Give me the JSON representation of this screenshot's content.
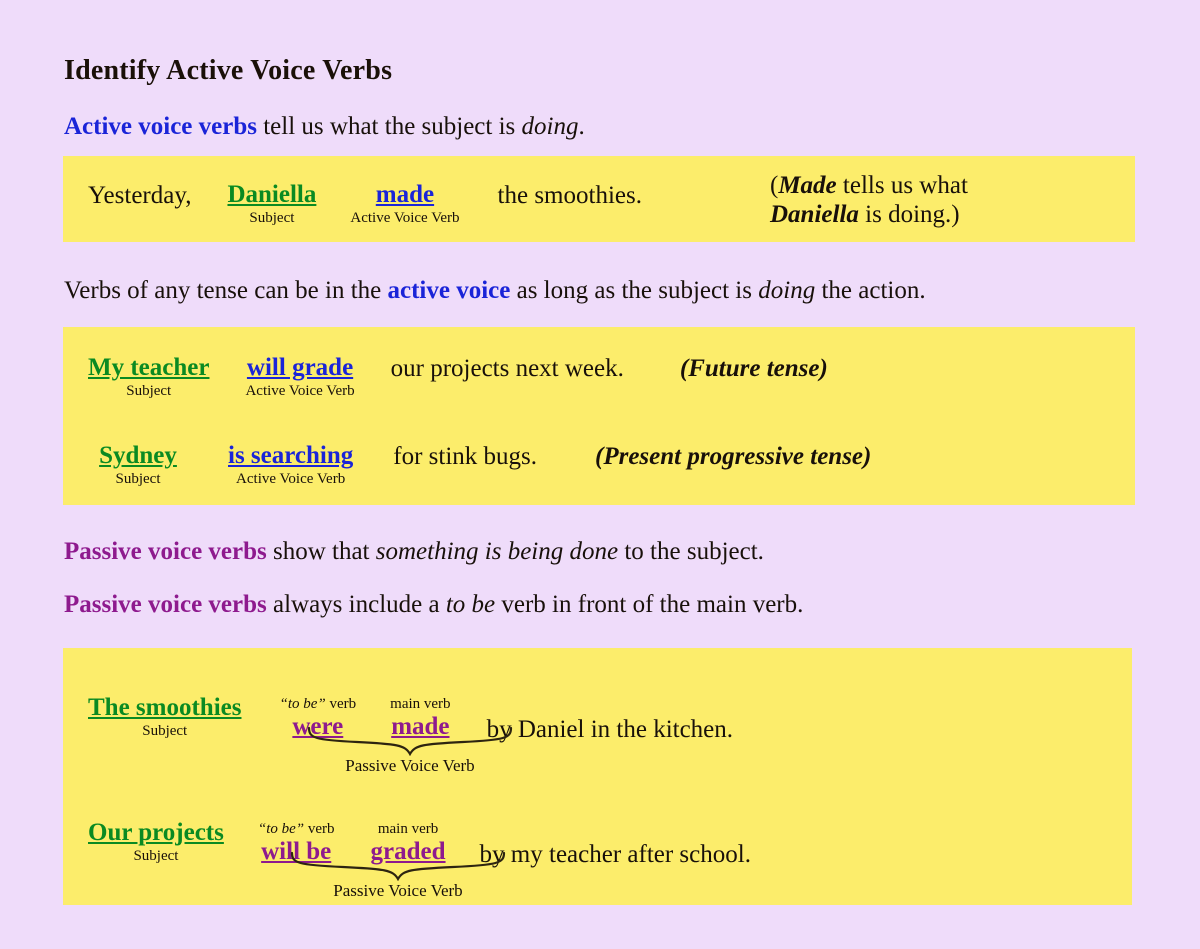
{
  "slide": {
    "title": "Identify Active Voice Verbs",
    "background_color": "#efdcfa",
    "box_color": "#fced6b",
    "accent_colors": {
      "subject_green": "#0a8a22",
      "active_verb_blue": "#1a24d8",
      "passive_verb_purple": "#8e1a8e",
      "text_black": "#18100a"
    }
  },
  "intro": {
    "emphasis": "Active voice verbs",
    "rest_a": " tell us what the subject is ",
    "italic": "doing",
    "rest_b": "."
  },
  "example_1": {
    "lead": "Yesterday,",
    "subject": {
      "word": "Daniella",
      "caption": "Subject"
    },
    "verb": {
      "word": "made",
      "caption": "Active Voice Verb"
    },
    "tail": "the smoothies.",
    "note_line_1_bold": "Made",
    "note_line_1_rest": " tells us what",
    "note_line_2_bold": "Daniella",
    "note_line_2_rest": " is doing.)",
    "note_open_paren": "("
  },
  "tense_line": {
    "part_a": "Verbs of any tense can be in the ",
    "emphasis": "active voice",
    "part_b": " as long as the subject is ",
    "italic": "doing",
    "part_c": " the action."
  },
  "example_2": {
    "subject": {
      "word": "My teacher",
      "caption": "Subject"
    },
    "verb": {
      "word": "will grade",
      "caption": "Active Voice Verb"
    },
    "tail": "our projects next week.",
    "tense_note": "(Future tense)"
  },
  "example_3": {
    "subject": {
      "word": "Sydney",
      "caption": "Subject"
    },
    "verb": {
      "word": "is searching",
      "caption": "Active Voice Verb"
    },
    "tail": "for stink bugs.",
    "tense_note": "(Present progressive tense)"
  },
  "passive_line_1": {
    "emphasis": "Passive voice verbs",
    "part_a": " show that ",
    "italic": "something is being done",
    "part_b": " to the subject."
  },
  "passive_line_2": {
    "emphasis": "Passive voice verbs",
    "part_a": " always include a ",
    "italic": "to be",
    "part_b": " verb in front of the main verb."
  },
  "example_4": {
    "subject": {
      "word": "The smoothies",
      "caption": "Subject"
    },
    "to_be": {
      "word": "were",
      "caption_italic": "“to be”",
      "caption_rest": " verb"
    },
    "main_verb": {
      "word": "made",
      "caption": "main verb"
    },
    "brace_label": "Passive Voice Verb",
    "tail": "by Daniel in the kitchen."
  },
  "example_5": {
    "subject": {
      "word": "Our projects",
      "caption": "Subject"
    },
    "to_be": {
      "word": "will be",
      "caption_italic": "“to be”",
      "caption_rest": " verb"
    },
    "main_verb": {
      "word": "graded",
      "caption": "main verb"
    },
    "brace_label": "Passive Voice Verb",
    "tail": "by my teacher after school."
  }
}
